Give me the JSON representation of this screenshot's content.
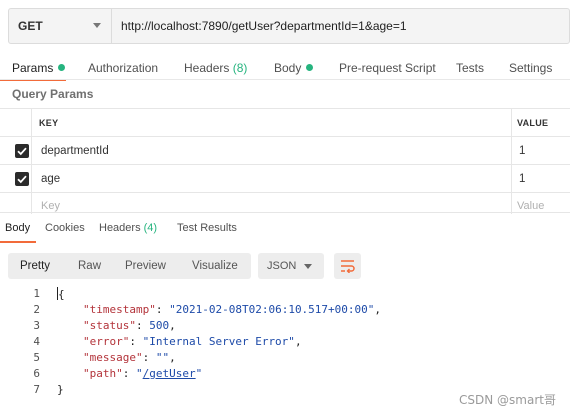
{
  "request": {
    "method": "GET",
    "url": "http://localhost:7890/getUser?departmentId=1&age=1"
  },
  "request_tabs": {
    "params": "Params",
    "authorization": "Authorization",
    "headers": "Headers",
    "headers_count": "(8)",
    "body": "Body",
    "pre_request": "Pre-request Script",
    "tests": "Tests",
    "settings": "Settings"
  },
  "query_params": {
    "title": "Query Params",
    "columns": {
      "key": "KEY",
      "value": "VALUE"
    },
    "rows": [
      {
        "checked": true,
        "key": "departmentId",
        "value": "1"
      },
      {
        "checked": true,
        "key": "age",
        "value": "1"
      }
    ],
    "placeholder": {
      "key": "Key",
      "value": "Value"
    }
  },
  "response_tabs": {
    "body": "Body",
    "cookies": "Cookies",
    "headers": "Headers",
    "headers_count": "(4)",
    "test_results": "Test Results"
  },
  "view_modes": {
    "pretty": "Pretty",
    "raw": "Raw",
    "preview": "Preview",
    "visualize": "Visualize",
    "format": "JSON"
  },
  "response_body": {
    "line_numbers": [
      "1",
      "2",
      "3",
      "4",
      "5",
      "6",
      "7"
    ],
    "open_brace": "{",
    "close_brace": "}",
    "fields": [
      {
        "key": "\"timestamp\"",
        "value": "\"2021-02-08T02:06:10.517+00:00\"",
        "trail": ","
      },
      {
        "key": "\"status\"",
        "value": "500",
        "trail": ","
      },
      {
        "key": "\"error\"",
        "value": "\"Internal Server Error\"",
        "trail": ","
      },
      {
        "key": "\"message\"",
        "value": "\"\"",
        "trail": ","
      },
      {
        "key": "\"path\"",
        "value_pre": "\"",
        "value_link": "/getUser",
        "value_post": "\"",
        "trail": ""
      }
    ]
  },
  "watermark": "CSDN @smart哥",
  "colors": {
    "accent": "#f26b3a",
    "status_dot": "#26b47f",
    "json_key": "#b3333a",
    "json_value": "#1d4aa8"
  }
}
